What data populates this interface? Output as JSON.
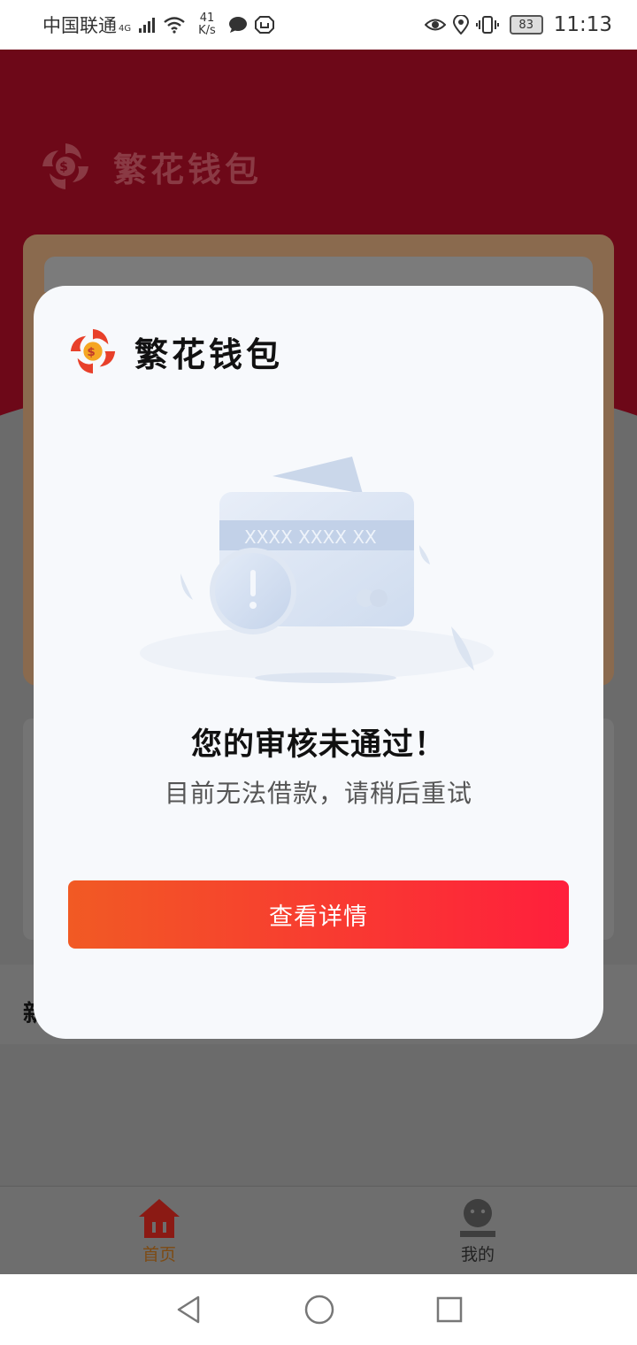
{
  "status_bar": {
    "carrier": "中国联通",
    "network_type": "4G",
    "net_speed_value": "41",
    "net_speed_unit": "K/s",
    "battery": "83",
    "time": "11:13"
  },
  "header": {
    "app_name": "繁花钱包"
  },
  "background": {
    "partial_text": "新"
  },
  "dialog": {
    "app_name": "繁花钱包",
    "card_mask_text": "XXXX XXXX XX",
    "title": "您的审核未通过！",
    "subtitle": "目前无法借款，请稍后重试",
    "button_label": "查看详情"
  },
  "tab_bar": {
    "items": [
      {
        "label": "首页",
        "icon": "home-icon",
        "active": true
      },
      {
        "label": "我的",
        "icon": "user-icon",
        "active": false
      }
    ]
  },
  "colors": {
    "header_bg": "#6d0818",
    "overlay_gray": "#6b6b6b",
    "button_gradient_start": "#f15a24",
    "button_gradient_end": "#ff1f3c",
    "active_tab": "#7d4b14"
  }
}
